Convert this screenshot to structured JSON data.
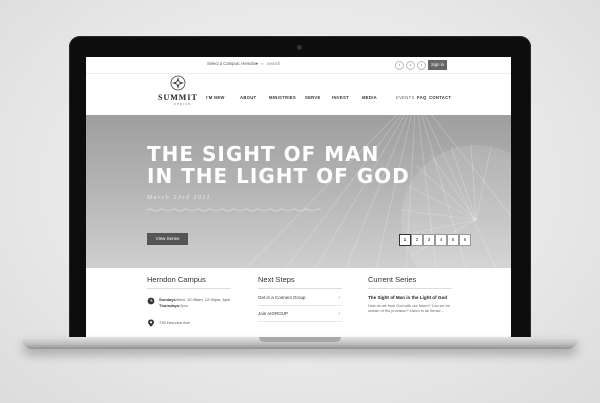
{
  "site": {
    "campus_select": "Select a Campus: Herndon",
    "search_placeholder": "Search",
    "social": [
      "t",
      "v",
      "f"
    ],
    "signin": "Sign in",
    "logo": {
      "name": "SUMMIT",
      "sub": "church"
    },
    "nav": [
      "I'M NEW",
      "ABOUT",
      "MINISTRIES",
      "SERVE",
      "INVEST",
      "MEDIA",
      "EVENTS",
      "FAQ",
      "CONTACT"
    ]
  },
  "hero": {
    "title_line1": "THE SIGHT OF MAN",
    "title_line2": "IN THE LIGHT OF GOD",
    "date": "March 23rd 2011",
    "button": "View Series",
    "pages": [
      "1",
      "2",
      "3",
      "4",
      "5",
      "6"
    ],
    "active_page": 1
  },
  "herndon": {
    "title": "Herndon Campus",
    "times_label": "Sundays:",
    "times_sun": "9am, 10:45am, 12:30pm, 6pm",
    "times_thu_label": "Thursdays:",
    "times_thu": "7pm",
    "address": "735 Herndon Ave"
  },
  "next_steps": {
    "title": "Next Steps",
    "items": [
      "Get in a Connect Group",
      "Join reGROUP"
    ]
  },
  "current_series": {
    "title": "Current Series",
    "series_title": "The Sight of Man in the Light of God",
    "description": "How do we trust God with our future? Can we be certain of His provision? Listen in as Senior..."
  }
}
